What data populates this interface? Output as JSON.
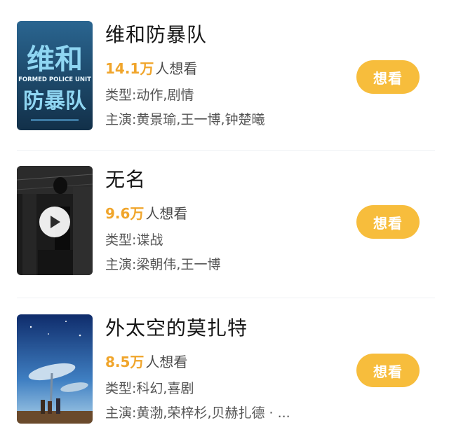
{
  "movies": [
    {
      "title": "维和防暴队",
      "want_count": "14.1万",
      "want_suffix": "人想看",
      "genre": "类型:动作,剧情",
      "cast": "主演:黄景瑜,王一博,钟楚曦",
      "button": "想看",
      "poster_text": {
        "line1": "维和",
        "line2": "FORMED POLICE UNIT",
        "line3": "防暴队"
      },
      "poster_colors": {
        "bg": "#1e4f73",
        "text": "#8fd6f2"
      }
    },
    {
      "title": "无名",
      "want_count": "9.6万",
      "want_suffix": "人想看",
      "genre": "类型:谍战",
      "cast": "主演:梁朝伟,王一博",
      "button": "想看",
      "has_play_icon": true,
      "poster_colors": {
        "bg": "#1f1f1f"
      }
    },
    {
      "title": "外太空的莫扎特",
      "want_count": "8.5万",
      "want_suffix": "人想看",
      "genre": "类型:科幻,喜剧",
      "cast": "主演:黄渤,荣梓杉,贝赫扎德 · ...",
      "button": "想看",
      "poster_colors": {
        "sky_top": "#0f2c6b",
        "sky_bottom": "#5fa6d9"
      }
    }
  ],
  "colors": {
    "accent": "#f0a52b",
    "button_bg": "#f7bd3c",
    "title_text": "#161616",
    "meta_text": "#555555"
  }
}
